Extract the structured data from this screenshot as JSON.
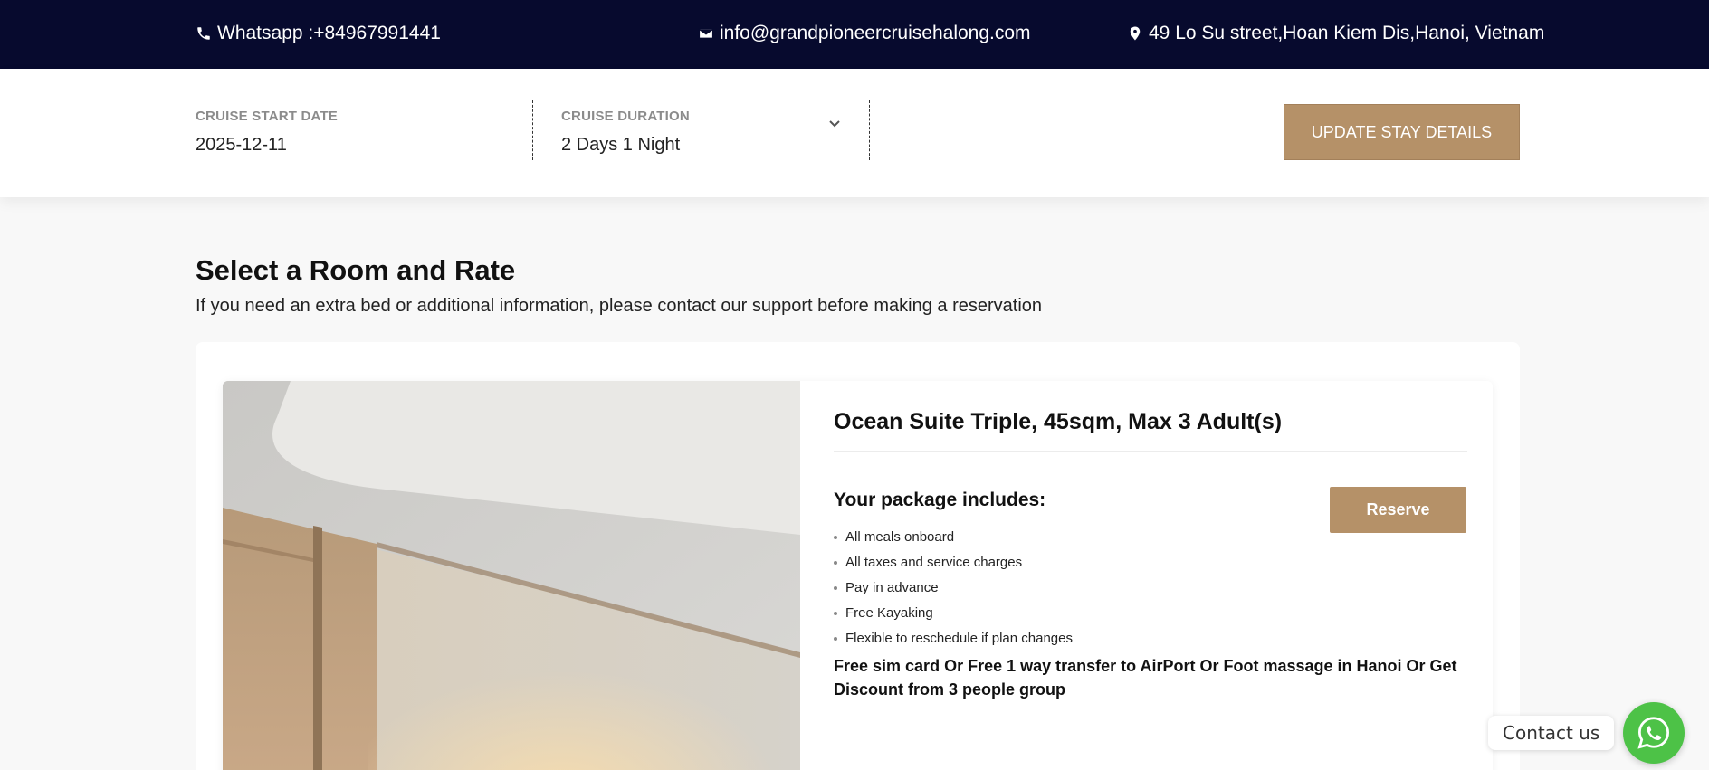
{
  "topbar": {
    "phone_text": "Whatsapp :+84967991441",
    "email_text": "info@grandpioneercruisehalong.com",
    "address_text": "49 Lo Su street,Hoan Kiem Dis,Hanoi, Vietnam",
    "background": "#070a2e",
    "icons": [
      "phone-icon",
      "envelope-icon",
      "map-marker-icon"
    ]
  },
  "stay": {
    "start_date_label": "CRUISE START DATE",
    "start_date_value": "2025-12-11",
    "duration_label": "CRUISE DURATION",
    "duration_value": "2 Days 1 Night",
    "update_label": "UPDATE STAY DETAILS",
    "accent": "#b59168"
  },
  "main": {
    "title": "Select a Room and Rate",
    "subtitle": "If you need an extra bed or additional information, please contact our support before making a reservation"
  },
  "room": {
    "title": "Ocean Suite Triple, 45sqm, Max 3 Adult(s)",
    "package_title": "Your package includes:",
    "includes": [
      "All meals onboard",
      "All taxes and service charges",
      "Pay in advance",
      "Free Kayaking",
      "Flexible to reschedule if plan changes"
    ],
    "promo": "Free sim card Or Free 1 way transfer to AirPort Or Foot massage in Hanoi Or Get Discount from 3 people group",
    "reserve_label": "Reserve"
  },
  "widget": {
    "contact_label": "Contact us",
    "whatsapp_color": "#4dc247"
  }
}
